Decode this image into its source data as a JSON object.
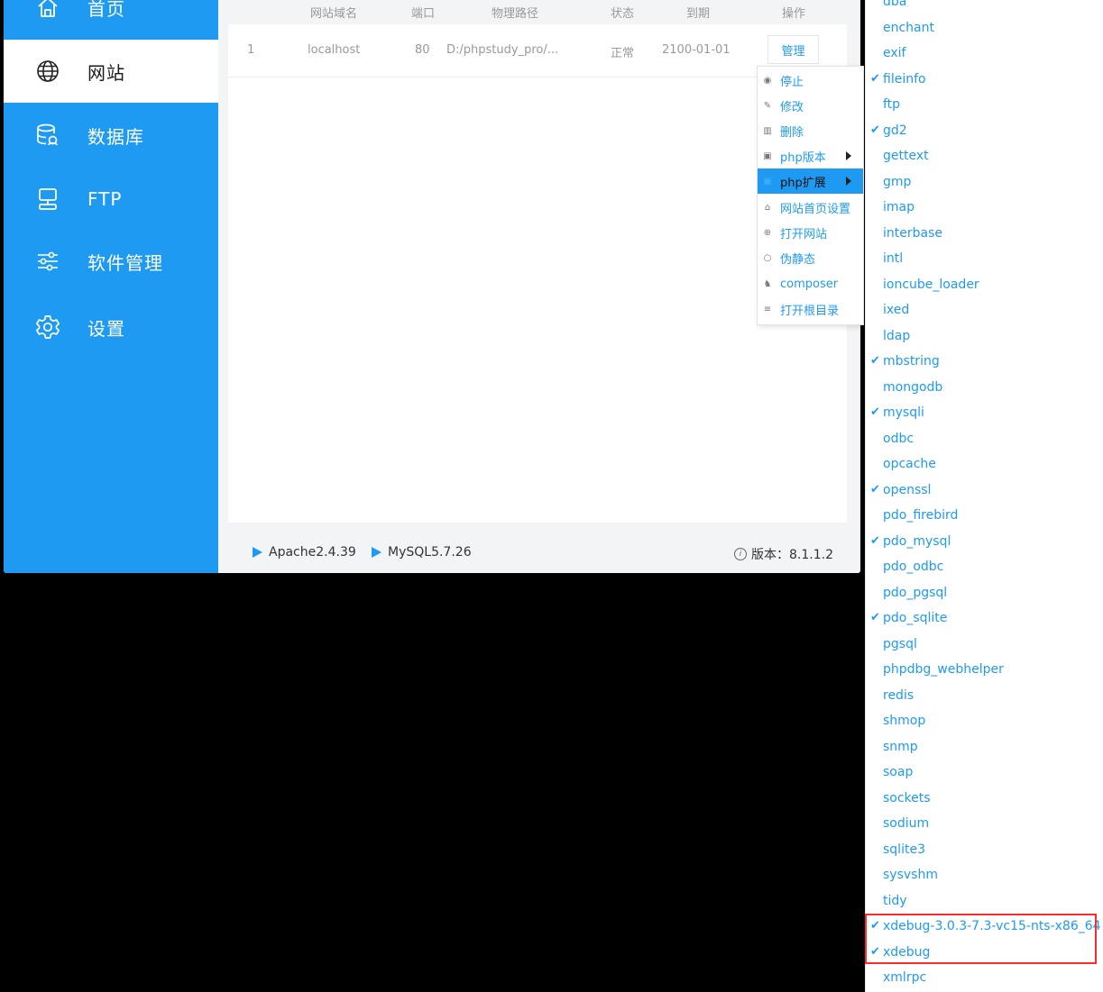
{
  "sidebar": {
    "items": [
      {
        "label": "首页",
        "icon": "home-icon",
        "active": false
      },
      {
        "label": "网站",
        "icon": "globe-icon",
        "active": true
      },
      {
        "label": "数据库",
        "icon": "database-icon",
        "active": false
      },
      {
        "label": "FTP",
        "icon": "ftp-server-icon",
        "active": false
      },
      {
        "label": "软件管理",
        "icon": "sliders-icon",
        "active": false
      },
      {
        "label": "设置",
        "icon": "gear-icon",
        "active": false
      }
    ]
  },
  "table": {
    "headers": {
      "domain": "网站域名",
      "port": "端口",
      "path": "物理路径",
      "status": "状态",
      "expire": "到期",
      "action": "操作"
    },
    "rows": [
      {
        "index": "1",
        "domain": "localhost",
        "port": "80",
        "path": "D:/phpstudy_pro/...",
        "status": "正常",
        "expire": "2100-01-01",
        "action": "管理"
      }
    ]
  },
  "context_menu": {
    "items": [
      {
        "label": "停止",
        "icon": "stop-icon"
      },
      {
        "label": "修改",
        "icon": "pencil-icon"
      },
      {
        "label": "删除",
        "icon": "trash-icon"
      },
      {
        "label": "php版本",
        "icon": "php-version-icon"
      },
      {
        "label": "php扩展",
        "icon": "php-extension-icon",
        "active": true
      },
      {
        "label": "网站首页设置",
        "icon": "home-settings-icon"
      },
      {
        "label": "打开网站",
        "icon": "open-site-icon"
      },
      {
        "label": "伪静态",
        "icon": "rewrite-icon"
      },
      {
        "label": "composer",
        "icon": "composer-icon"
      },
      {
        "label": "打开根目录",
        "icon": "folder-list-icon"
      }
    ]
  },
  "extensions": [
    {
      "name": "dba",
      "checked": false
    },
    {
      "name": "enchant",
      "checked": false
    },
    {
      "name": "exif",
      "checked": false
    },
    {
      "name": "fileinfo",
      "checked": true
    },
    {
      "name": "ftp",
      "checked": false
    },
    {
      "name": "gd2",
      "checked": true
    },
    {
      "name": "gettext",
      "checked": false
    },
    {
      "name": "gmp",
      "checked": false
    },
    {
      "name": "imap",
      "checked": false
    },
    {
      "name": "interbase",
      "checked": false
    },
    {
      "name": "intl",
      "checked": false
    },
    {
      "name": "ioncube_loader",
      "checked": false
    },
    {
      "name": "ixed",
      "checked": false
    },
    {
      "name": "ldap",
      "checked": false
    },
    {
      "name": "mbstring",
      "checked": true
    },
    {
      "name": "mongodb",
      "checked": false
    },
    {
      "name": "mysqli",
      "checked": true
    },
    {
      "name": "odbc",
      "checked": false
    },
    {
      "name": "opcache",
      "checked": false
    },
    {
      "name": "openssl",
      "checked": true
    },
    {
      "name": "pdo_firebird",
      "checked": false
    },
    {
      "name": "pdo_mysql",
      "checked": true
    },
    {
      "name": "pdo_odbc",
      "checked": false
    },
    {
      "name": "pdo_pgsql",
      "checked": false
    },
    {
      "name": "pdo_sqlite",
      "checked": true
    },
    {
      "name": "pgsql",
      "checked": false
    },
    {
      "name": "phpdbg_webhelper",
      "checked": false
    },
    {
      "name": "redis",
      "checked": false
    },
    {
      "name": "shmop",
      "checked": false
    },
    {
      "name": "snmp",
      "checked": false
    },
    {
      "name": "soap",
      "checked": false
    },
    {
      "name": "sockets",
      "checked": false
    },
    {
      "name": "sodium",
      "checked": false
    },
    {
      "name": "sqlite3",
      "checked": false
    },
    {
      "name": "sysvshm",
      "checked": false
    },
    {
      "name": "tidy",
      "checked": false
    },
    {
      "name": "xdebug-3.0.3-7.3-vc15-nts-x86_64",
      "checked": true
    },
    {
      "name": "xdebug",
      "checked": true
    },
    {
      "name": "xmlrpc",
      "checked": false
    }
  ],
  "check_mark": "✔",
  "footer": {
    "apache": "Apache2.4.39",
    "mysql": "MySQL5.7.26",
    "version": "版本：8.1.1.2",
    "info_glyph": "i"
  },
  "colors": {
    "accent": "#1e9af2",
    "highlight": "#ff2a2a"
  }
}
